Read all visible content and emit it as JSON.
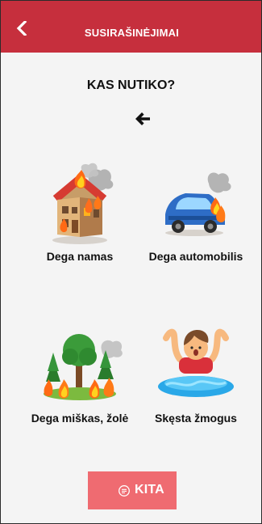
{
  "header": {
    "title": "SUSIRAŠINĖJIMAI",
    "back_icon": "chevron-left-icon",
    "background_color": "#c62f3d"
  },
  "main": {
    "question": "KAS NUTIKO?",
    "prompt_icon": "arrow-left-icon"
  },
  "options": [
    {
      "id": "house",
      "label": "Dega namas",
      "illustration": "burning-house-icon"
    },
    {
      "id": "car",
      "label": "Dega automobilis",
      "illustration": "burning-car-icon"
    },
    {
      "id": "forest",
      "label": "Dega miškas, žolė",
      "illustration": "forest-fire-icon"
    },
    {
      "id": "drowning",
      "label": "Skęsta žmogus",
      "illustration": "drowning-person-icon"
    }
  ],
  "footer": {
    "button_label": "KITA",
    "button_icon": "chat-bubble-icon",
    "button_color": "#ef6b71"
  }
}
